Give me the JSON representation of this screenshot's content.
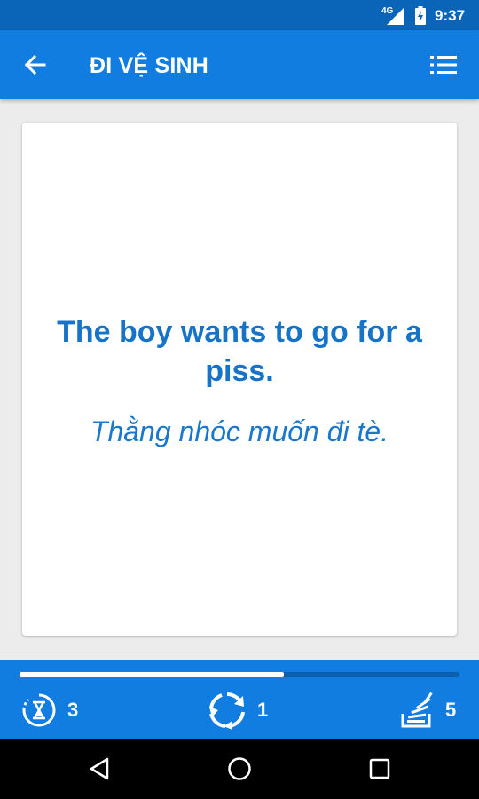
{
  "status_bar": {
    "network": "4G",
    "time": "9:37"
  },
  "app_bar": {
    "title": "ĐI VỆ SINH",
    "back_icon": "arrow-left-icon",
    "menu_icon": "list-icon"
  },
  "card": {
    "english": "The boy wants to go for a piss.",
    "vietnamese": "Thằng nhóc muốn đi tè."
  },
  "progress": {
    "fraction": 0.6
  },
  "stats": [
    {
      "icon": "hourglass-icon",
      "value": "3"
    },
    {
      "icon": "refresh-icon",
      "value": "1"
    },
    {
      "icon": "stack-icon",
      "value": "5"
    }
  ],
  "colors": {
    "primary": "#117de0",
    "status_bar": "#0a64b8",
    "text_blue": "#1673c8"
  }
}
